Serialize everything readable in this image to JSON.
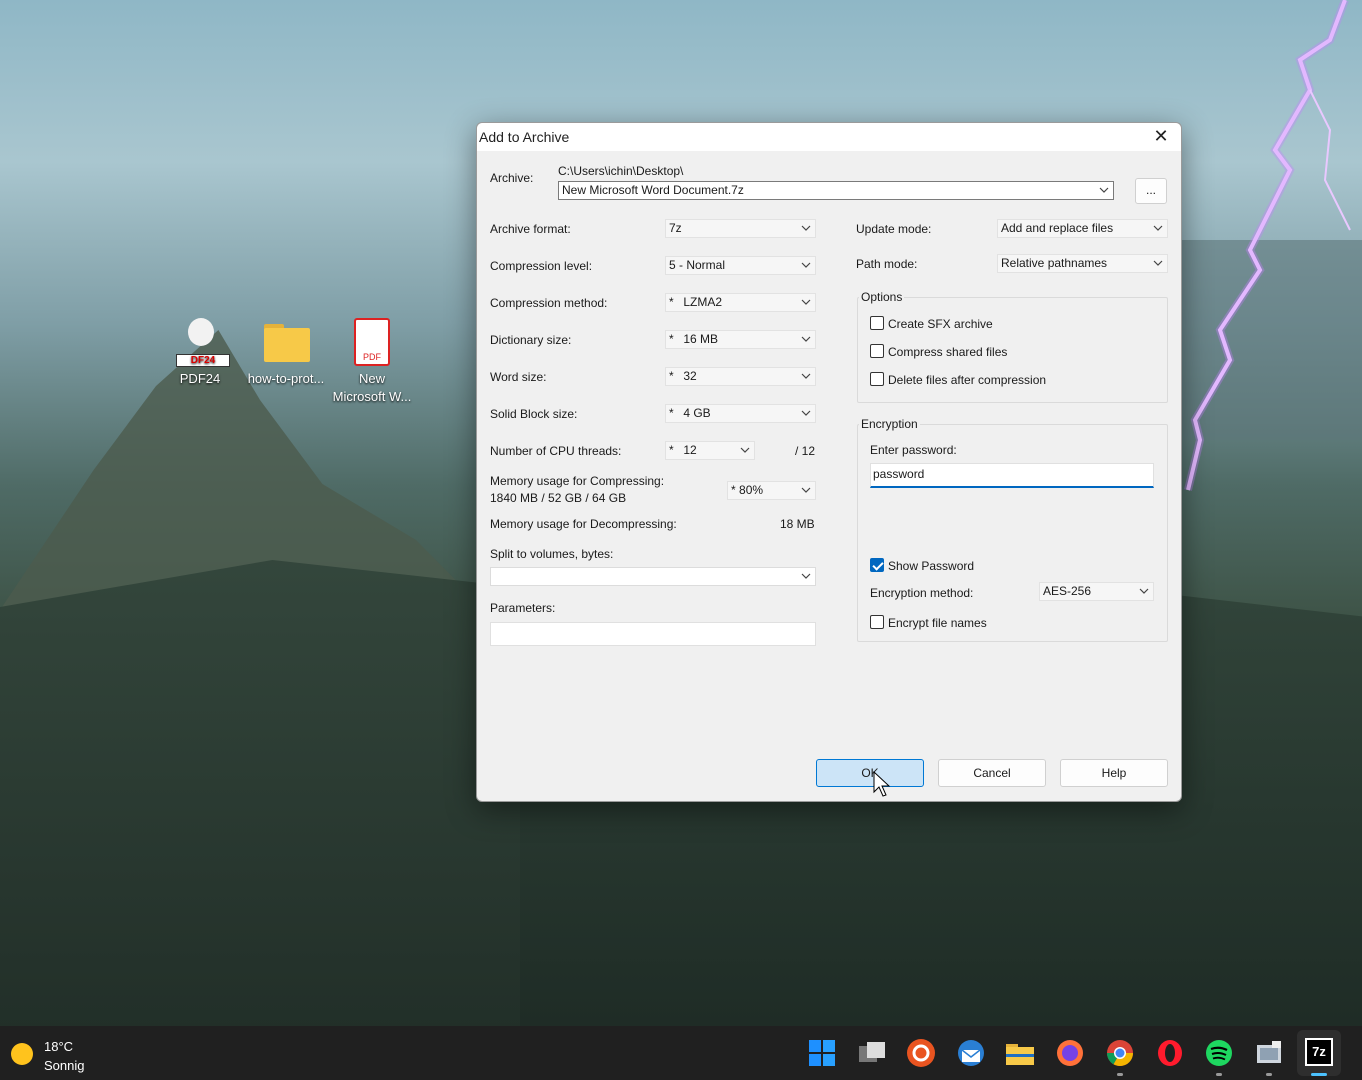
{
  "desktop": {
    "icons": [
      {
        "label": "PDF24"
      },
      {
        "label": "how-to-prot..."
      },
      {
        "label_line1": "New",
        "label_line2": "Microsoft W..."
      }
    ],
    "pdf_badge": "PDF",
    "pdf24_badge": "DF24"
  },
  "dialog": {
    "title": "Add to Archive",
    "archive": {
      "label": "Archive:",
      "path": "C:\\Users\\ichin\\Desktop\\",
      "filename": "New Microsoft Word Document.7z",
      "browse": "..."
    },
    "left": {
      "format_label": "Archive format:",
      "format_value": "7z",
      "level_label": "Compression level:",
      "level_value": "5 - Normal",
      "method_label": "Compression method:",
      "method_value": "LZMA2",
      "dict_label": "Dictionary size:",
      "dict_value": "16 MB",
      "word_label": "Word size:",
      "word_value": "32",
      "solid_label": "Solid Block size:",
      "solid_value": "4 GB",
      "threads_label": "Number of CPU threads:",
      "threads_value": "12",
      "threads_max": "/ 12",
      "memc_label": "Memory usage for Compressing:",
      "memc_detail": "1840 MB / 52 GB / 64 GB",
      "memc_value": "80%",
      "memd_label": "Memory usage for Decompressing:",
      "memd_value": "18 MB",
      "split_label": "Split to volumes, bytes:",
      "split_value": "",
      "params_label": "Parameters:",
      "params_value": "",
      "star": "*"
    },
    "right": {
      "update_label": "Update mode:",
      "update_value": "Add and replace files",
      "path_label": "Path mode:",
      "path_value": "Relative pathnames",
      "options_title": "Options",
      "opt_sfx": "Create SFX archive",
      "opt_shared": "Compress shared files",
      "opt_delete": "Delete files after compression",
      "enc_title": "Encryption",
      "enc_pwd_label": "Enter password:",
      "enc_pwd_value": "password",
      "enc_show": "Show Password",
      "enc_method_label": "Encryption method:",
      "enc_method_value": "AES-256",
      "enc_names": "Encrypt file names"
    },
    "buttons": {
      "ok": "OK",
      "cancel": "Cancel",
      "help": "Help"
    }
  },
  "taskbar": {
    "temp": "18°C",
    "condition": "Sonnig",
    "active_app": "7z"
  },
  "colors": {
    "accent": "#0067c0",
    "ok_bg": "#cce4f7",
    "taskbar": "#202020"
  }
}
